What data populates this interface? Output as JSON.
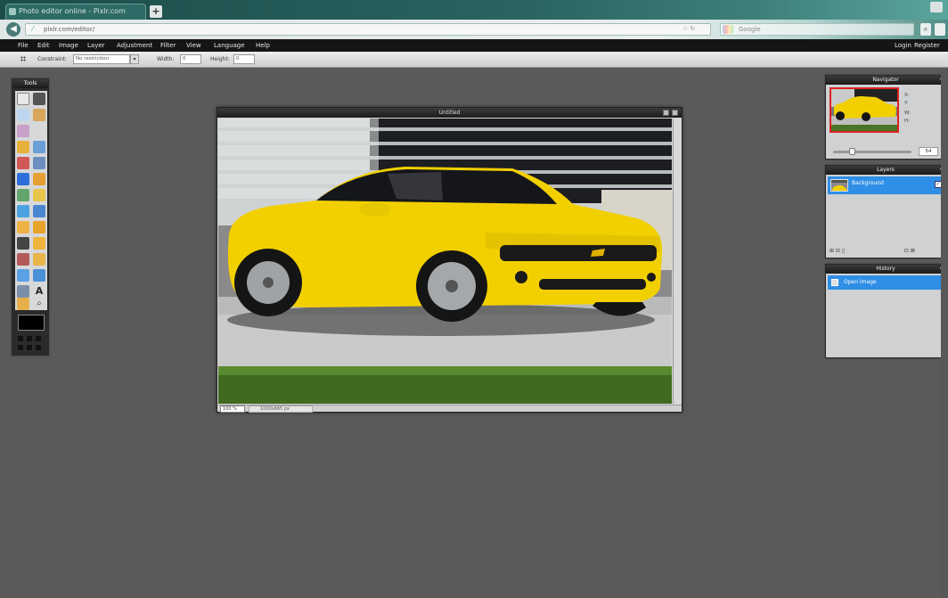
{
  "browser": {
    "tab_title": "Photo editor online - Pixlr.com",
    "newtab_label": "+",
    "url": "pixlr.com/editor/",
    "search_placeholder": "Google",
    "back_label": "◀"
  },
  "menu": {
    "items": [
      "File",
      "Edit",
      "Image",
      "Layer",
      "Adjustment",
      "Filter",
      "View",
      "Language",
      "Help"
    ],
    "right": [
      "Login",
      "Register"
    ]
  },
  "options": {
    "constraint_label": "Constraint:",
    "constraint_value": "No restriction",
    "width_label": "Width:",
    "width_value": "0",
    "height_label": "Height:",
    "height_value": "0"
  },
  "tools": {
    "title": "Tools"
  },
  "document": {
    "title": "Untitled",
    "zoom": "100 %",
    "size": "1000x665 px"
  },
  "navigator": {
    "title": "Navigator",
    "x_label": "X:",
    "y_label": "Y:",
    "w_label": "W:",
    "h_label": "H:",
    "zoom_value": "54"
  },
  "layers": {
    "title": "Layers",
    "layer_name": "Background"
  },
  "history": {
    "title": "History",
    "item": "Open image"
  },
  "colors": {
    "workspace": "#5a5a5a",
    "accent": "#2f8fe6",
    "car": "#f2d000"
  }
}
